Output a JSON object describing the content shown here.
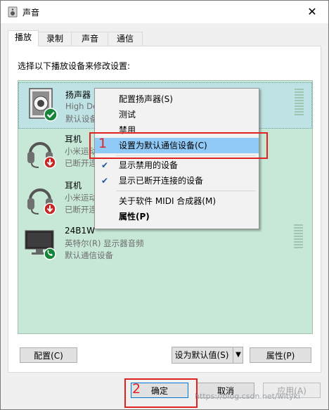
{
  "window": {
    "title": "声音",
    "close_glyph": "✕"
  },
  "tabs": [
    "播放",
    "录制",
    "声音",
    "通信"
  ],
  "instruction": "选择以下播放设备来修改设置:",
  "devices": [
    {
      "name": "扬声器",
      "line1": "High De",
      "line2": "默认设备",
      "badge": "check"
    },
    {
      "name": "耳机",
      "line1": "小米运动",
      "line2": "已断开连",
      "badge": "down"
    },
    {
      "name": "耳机",
      "line1": "小米运动",
      "line2": "已断开连",
      "badge": "down"
    },
    {
      "name": "24B1W",
      "line1": "英特尔(R) 显示器音频",
      "line2": "默认通信设备",
      "badge": "phone"
    }
  ],
  "context_menu": {
    "items": [
      "配置扬声器(S)",
      "测试",
      "禁用",
      "设置为默认通信设备(C)",
      "显示禁用的设备",
      "显示已断开连接的设备",
      "关于软件 MIDI 合成器(M)",
      "属性(P)"
    ],
    "check_glyph": "✔"
  },
  "annotations": {
    "one": "1",
    "two": "2"
  },
  "buttons": {
    "configure": "配置(C)",
    "set_default": "设为默认值(S)",
    "dropdown_glyph": "▼",
    "properties": "属性(P)",
    "ok": "确定",
    "cancel": "取消",
    "apply": "应用(A)"
  },
  "watermark": "https://blog.csdn.net/wityki"
}
